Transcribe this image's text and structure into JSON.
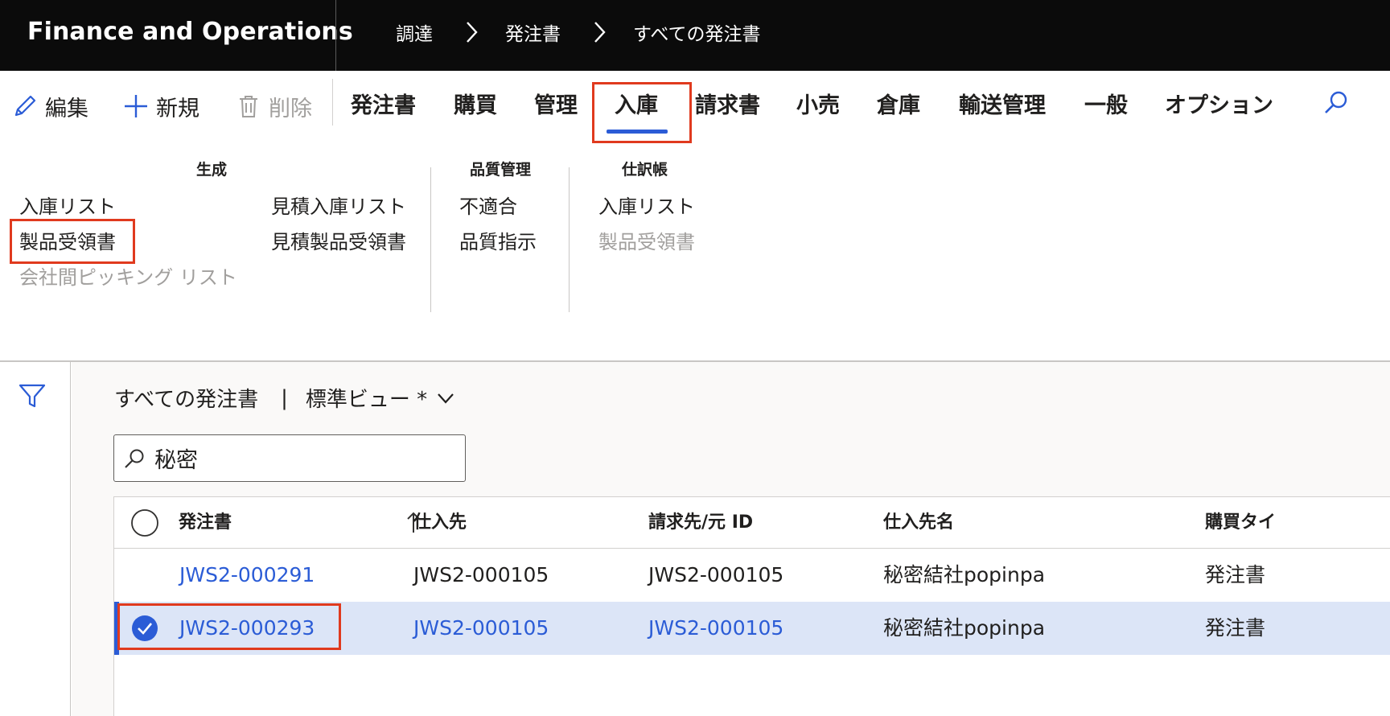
{
  "app": {
    "title": "Finance and Operations"
  },
  "breadcrumb": [
    "調達",
    "発注書",
    "すべての発注書"
  ],
  "actions": {
    "edit": "編集",
    "new": "新規",
    "delete": "削除"
  },
  "tabs": [
    "発注書",
    "購買",
    "管理",
    "入庫",
    "請求書",
    "小売",
    "倉庫",
    "輸送管理",
    "一般",
    "オプション"
  ],
  "active_tab": "入庫",
  "ribbon": {
    "groups": [
      {
        "title": "生成",
        "items": [
          "入庫リスト",
          "製品受領書",
          "会社間ピッキング リスト",
          "見積入庫リスト",
          "見積製品受領書"
        ]
      },
      {
        "title": "品質管理",
        "items": [
          "不適合",
          "品質指示"
        ]
      },
      {
        "title": "仕訳帳",
        "items": [
          "入庫リスト",
          "製品受領書"
        ]
      }
    ]
  },
  "view": {
    "title": "すべての発注書",
    "separator": "|",
    "name": "標準ビュー *"
  },
  "search": {
    "value": "秘密"
  },
  "grid": {
    "columns": [
      "発注書",
      "仕入先",
      "請求先/元 ID",
      "仕入先名",
      "購買タイ"
    ],
    "rows": [
      {
        "po": "JWS2-000291",
        "vendor": "JWS2-000105",
        "invoice_id": "JWS2-000105",
        "vendor_name": "秘密結社popinpa",
        "type": "発注書",
        "selected": false
      },
      {
        "po": "JWS2-000293",
        "vendor": "JWS2-000105",
        "invoice_id": "JWS2-000105",
        "vendor_name": "秘密結社popinpa",
        "type": "発注書",
        "selected": true
      }
    ]
  },
  "colors": {
    "accent": "#2b5cd6",
    "highlight": "#e03a1e",
    "topbar": "#0b0b0b",
    "selected_row": "#dce5f7"
  }
}
